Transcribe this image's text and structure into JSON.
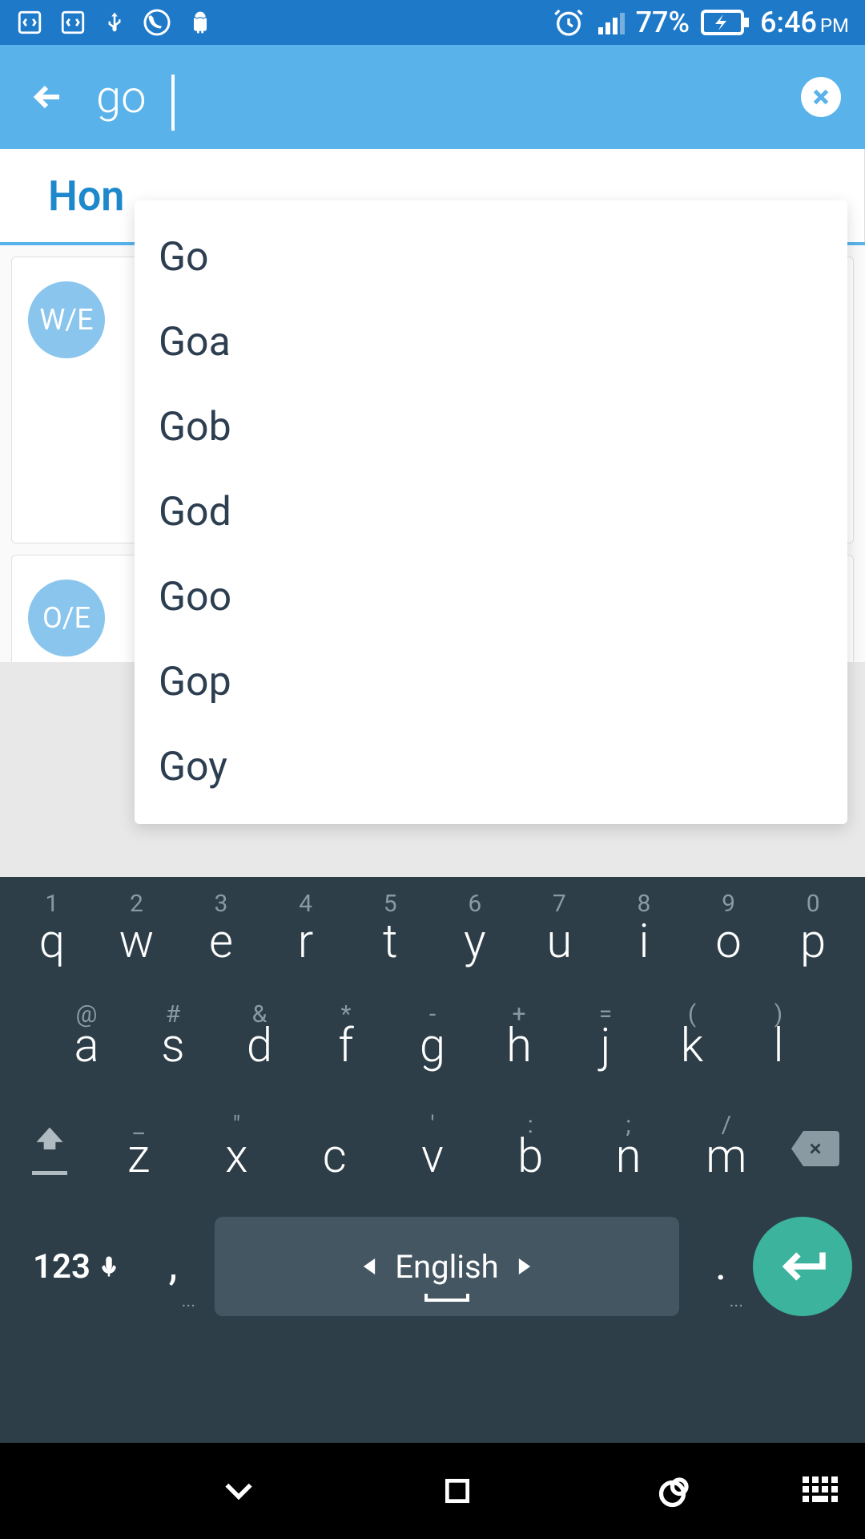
{
  "status": {
    "battery_pct": "77%",
    "time": "6:46",
    "ampm": "PM"
  },
  "search": {
    "value": "go"
  },
  "tabs": {
    "home_partial": "Hon"
  },
  "avatars": {
    "item0": "W/E",
    "item1": "O/E"
  },
  "suggestions": [
    "Go",
    "Goa",
    "Gob",
    "God",
    "Goo",
    "Gop",
    "Goy"
  ],
  "keyboard": {
    "row1_nums": [
      "1",
      "2",
      "3",
      "4",
      "5",
      "6",
      "7",
      "8",
      "9",
      "0"
    ],
    "row1_keys": [
      "q",
      "w",
      "e",
      "r",
      "t",
      "y",
      "u",
      "i",
      "o",
      "p"
    ],
    "row2_syms": [
      "@",
      "#",
      "&",
      "*",
      "-",
      "+",
      "=",
      "(",
      ")"
    ],
    "row2_keys": [
      "a",
      "s",
      "d",
      "f",
      "g",
      "h",
      "j",
      "k",
      "l"
    ],
    "row3_syms": [
      "_",
      "\"",
      "",
      "'",
      ":",
      ";",
      "/"
    ],
    "row3_keys": [
      "z",
      "x",
      "c",
      "v",
      "b",
      "n",
      "m"
    ],
    "lang": "English",
    "mode_label": "123",
    "comma": ",",
    "period": ".",
    "dots": "..."
  }
}
